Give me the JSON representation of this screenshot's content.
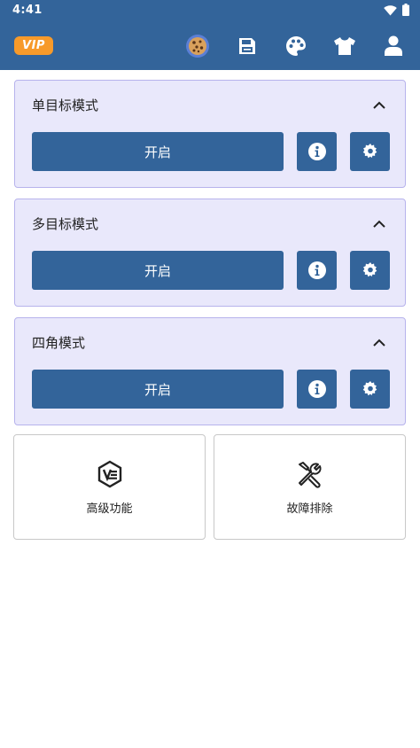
{
  "status_bar": {
    "time": "4:41"
  },
  "header": {
    "vip_label": "VIP",
    "icons": [
      "cookie-icon",
      "save-icon",
      "palette-icon",
      "shirt-icon",
      "user-icon"
    ]
  },
  "cards": [
    {
      "title": "单目标模式",
      "open_label": "开启"
    },
    {
      "title": "多目标模式",
      "open_label": "开启"
    },
    {
      "title": "四角模式",
      "open_label": "开启"
    }
  ],
  "tiles": [
    {
      "label": "高级功能",
      "icon": "advanced-features-icon"
    },
    {
      "label": "故障排除",
      "icon": "tools-icon"
    }
  ],
  "colors": {
    "primary": "#33649a",
    "card_bg": "#e9e8fb",
    "card_border": "#b7b3ec",
    "vip": "#f79a2a"
  }
}
